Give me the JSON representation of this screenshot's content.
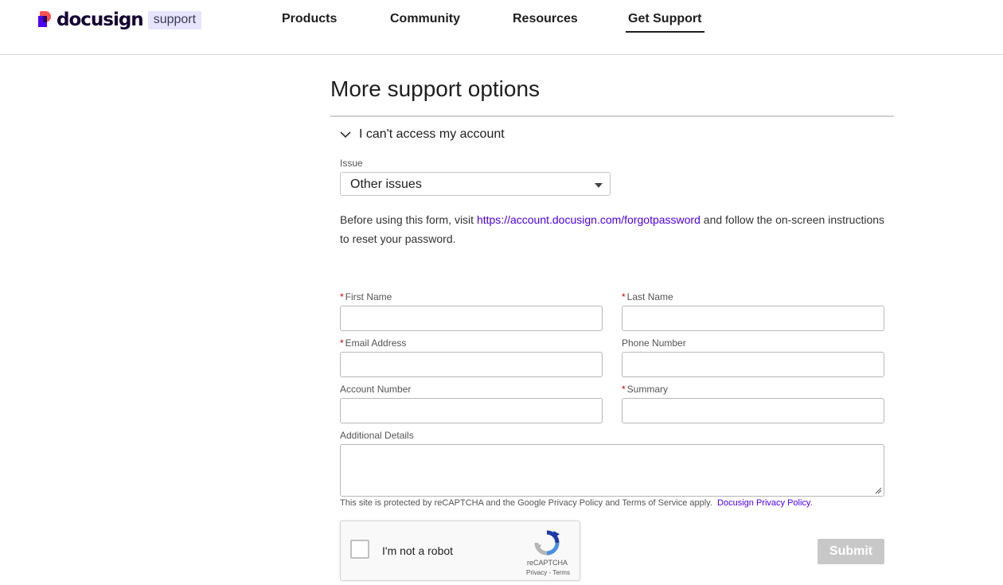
{
  "header": {
    "logo_word": "docusign",
    "logo_tag": "support",
    "nav": [
      "Products",
      "Community",
      "Resources",
      "Get Support"
    ],
    "active_nav": "Get Support"
  },
  "page": {
    "title": "More support options",
    "accordion_title": "I can't access my account"
  },
  "issue": {
    "label": "Issue",
    "selected": "Other issues"
  },
  "intro": {
    "before": "Before using this form, visit ",
    "link": "https://account.docusign.com/forgotpassword",
    "after": " and follow the on-screen instructions to reset your password."
  },
  "form": {
    "first_name": "First Name",
    "last_name": "Last Name",
    "email": "Email Address",
    "phone": "Phone Number",
    "account": "Account Number",
    "summary": "Summary",
    "additional": "Additional Details",
    "required_mark": "*"
  },
  "notice": {
    "text": "This site is protected by reCAPTCHA and the Google Privacy Policy and Terms of Service apply.",
    "link": "Docusign Privacy Policy."
  },
  "recaptcha": {
    "label": "I'm not a robot",
    "brand": "reCAPTCHA",
    "links": "Privacy - Terms"
  },
  "submit_label": "Submit",
  "colors": {
    "accent": "#4c00ff",
    "required": "#cc0000",
    "submit_disabled": "#c8c8c8"
  }
}
